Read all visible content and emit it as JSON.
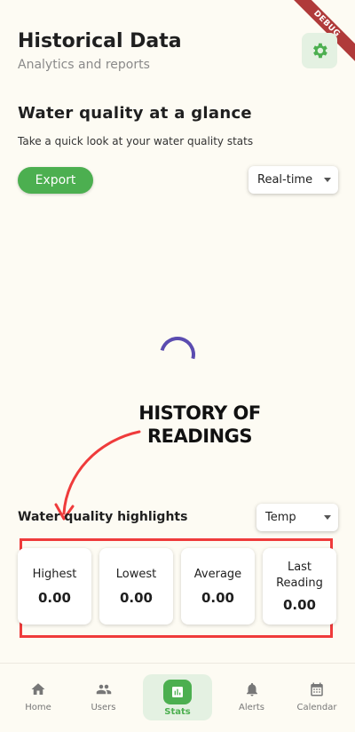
{
  "debug_banner": "DEBUG",
  "header": {
    "title": "Historical Data",
    "subtitle": "Analytics and reports"
  },
  "overview": {
    "title": "Water quality at a glance",
    "description": "Take a quick look at your water quality stats",
    "export_label": "Export",
    "range_select": "Real-time"
  },
  "annotation": {
    "line1": "HISTORY OF",
    "line2": "READINGS"
  },
  "highlights": {
    "title": "Water quality highlights",
    "param_select": "Temp",
    "cards": [
      {
        "label": "Highest",
        "value": "0.00"
      },
      {
        "label": "Lowest",
        "value": "0.00"
      },
      {
        "label": "Average",
        "value": "0.00"
      },
      {
        "label": "Last Reading",
        "value": "0.00"
      }
    ]
  },
  "nav": {
    "items": [
      {
        "label": "Home",
        "icon": "home-icon"
      },
      {
        "label": "Users",
        "icon": "users-icon"
      },
      {
        "label": "Stats",
        "icon": "stats-icon"
      },
      {
        "label": "Alerts",
        "icon": "bell-icon"
      },
      {
        "label": "Calendar",
        "icon": "calendar-icon"
      }
    ],
    "active": "Stats"
  },
  "colors": {
    "accent": "#4caf50",
    "background": "#fdfbf3",
    "spinner": "#5b4cb0",
    "annotation_red": "#ef3b3b"
  }
}
